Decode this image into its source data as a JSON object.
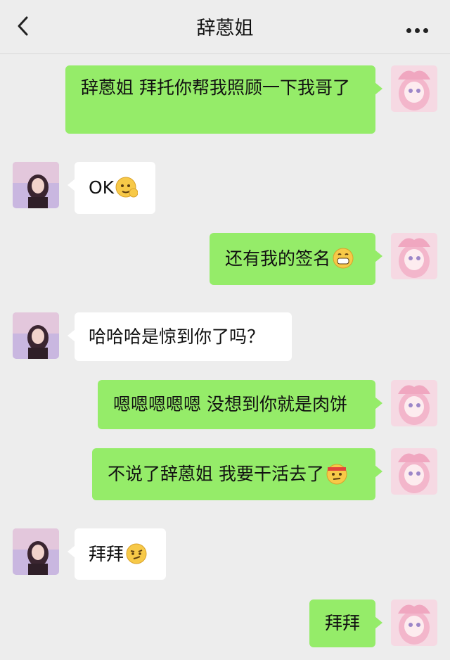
{
  "header": {
    "title": "辞蒽姐",
    "back_icon": "chevron-left-icon",
    "more_icon": "ellipsis-icon"
  },
  "messages": [
    {
      "from": "me",
      "text": "辞蒽姐 拜托你帮我照顾一下我哥了"
    },
    {
      "from": "other",
      "text": "OK",
      "emoji": "ok-hand-face-emoji"
    },
    {
      "from": "me",
      "text": "还有我的签名",
      "emoji": "grin-emoji"
    },
    {
      "from": "other",
      "text": "哈哈哈是惊到你了吗？"
    },
    {
      "from": "me",
      "text": "嗯嗯嗯嗯嗯 没想到你就是肉饼"
    },
    {
      "from": "me",
      "text": "不说了辞蒽姐 我要干活去了",
      "emoji": "headband-emoji"
    },
    {
      "from": "other",
      "text": "拜拜",
      "emoji": "smirk-emoji"
    },
    {
      "from": "me",
      "text": "拜拜"
    }
  ],
  "colors": {
    "background": "#ededed",
    "my_bubble": "#95ec69",
    "their_bubble": "#ffffff"
  }
}
